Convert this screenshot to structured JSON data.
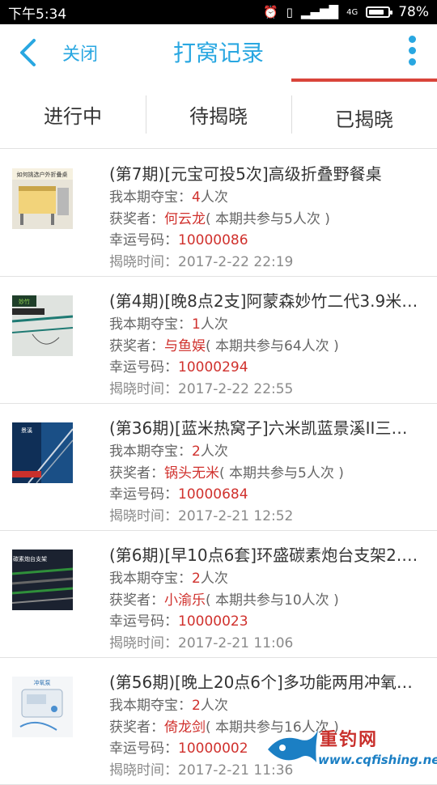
{
  "status_bar": {
    "time": "下午5:34",
    "network": "4G",
    "battery": "78%"
  },
  "header": {
    "close_label": "关闭",
    "title": "打窝记录"
  },
  "tabs": [
    {
      "label": "进行中"
    },
    {
      "label": "待揭晓"
    },
    {
      "label": "已揭晓",
      "active": true
    }
  ],
  "records": [
    {
      "title": "(第7期)[元宝可投5次]高级折叠野餐桌",
      "my_label": "我本期夺宝：",
      "my_count": "4",
      "my_unit": "人次",
      "winner_label": "获奖者：",
      "winner": "何云龙",
      "participation": "( 本期共参与5人次 )",
      "lucky_label": "幸运号码：",
      "lucky_number": "10000086",
      "time_label": "揭晓时间：",
      "time": "2017-2-22 22:19",
      "thumb_caption": "如何挑选户外折叠桌"
    },
    {
      "title": "(第4期)[晚8点2支]阿蒙森妙竹二代3.9米…",
      "my_label": "我本期夺宝：",
      "my_count": "1",
      "my_unit": "人次",
      "winner_label": "获奖者：",
      "winner": "与鱼娱",
      "participation": "( 本期共参与64人次 )",
      "lucky_label": "幸运号码：",
      "lucky_number": "10000294",
      "time_label": "揭晓时间：",
      "time": "2017-2-22 22:55",
      "thumb_caption": "妙竹"
    },
    {
      "title": "(第36期)[蓝米热窝子]六米凯蓝景溪II三…",
      "my_label": "我本期夺宝：",
      "my_count": "2",
      "my_unit": "人次",
      "winner_label": "获奖者：",
      "winner": "锅头无米",
      "participation": "( 本期共参与5人次 )",
      "lucky_label": "幸运号码：",
      "lucky_number": "10000684",
      "time_label": "揭晓时间：",
      "time": "2017-2-21 12:52",
      "thumb_caption": "景溪"
    },
    {
      "title": "(第6期)[早10点6套]环盛碳素炮台支架2.…",
      "my_label": "我本期夺宝：",
      "my_count": "2",
      "my_unit": "人次",
      "winner_label": "获奖者：",
      "winner": "小渝乐",
      "participation": "( 本期共参与10人次 )",
      "lucky_label": "幸运号码：",
      "lucky_number": "10000023",
      "time_label": "揭晓时间：",
      "time": "2017-2-21 11:06",
      "thumb_caption": "碳素炮台支架"
    },
    {
      "title": "(第56期)[晚上20点6个]多功能两用冲氧…",
      "my_label": "我本期夺宝：",
      "my_count": "2",
      "my_unit": "人次",
      "winner_label": "获奖者：",
      "winner": "倚龙剑",
      "participation": "( 本期共参与16人次 )",
      "lucky_label": "幸运号码：",
      "lucky_number": "10000002",
      "time_label": "揭晓时间：",
      "time": "2017-2-21 11:36",
      "thumb_caption": "冲氧泵"
    }
  ],
  "watermark": {
    "text": "重钓网",
    "url": "www.cqfishing.net"
  },
  "colors": {
    "accent": "#29a7e1",
    "highlight": "#d0312d",
    "tab_underline": "#d9443a"
  }
}
